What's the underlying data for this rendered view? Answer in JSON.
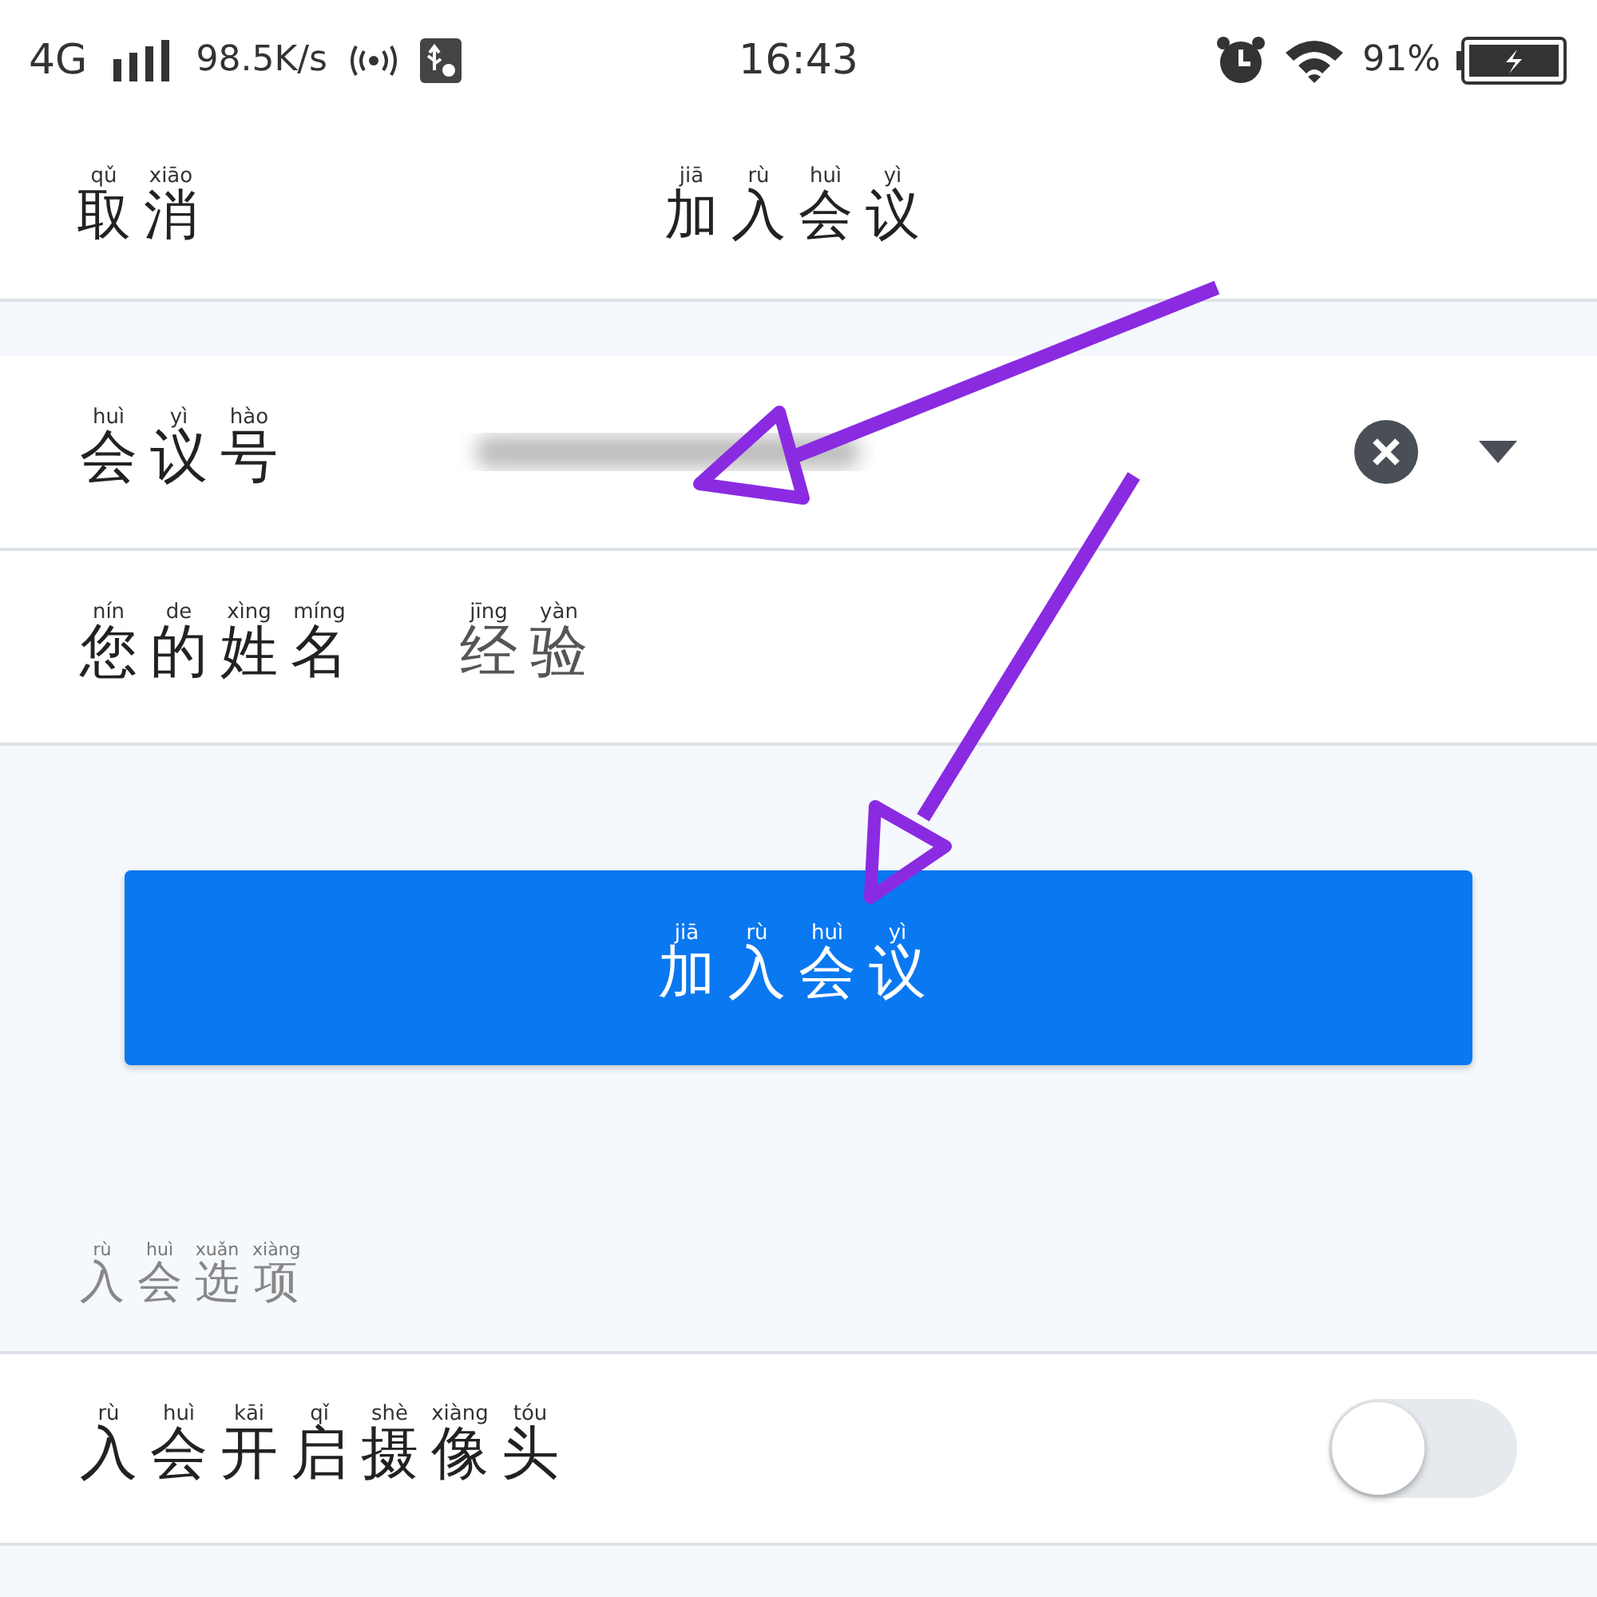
{
  "status_bar": {
    "network": "4G",
    "speed": "98.5K/s",
    "time": "16:43",
    "battery": "91%"
  },
  "header": {
    "cancel": [
      {
        "c": "取",
        "p": "qǔ"
      },
      {
        "c": "消",
        "p": "xiāo"
      }
    ],
    "title": [
      {
        "c": "加",
        "p": "jiā"
      },
      {
        "c": "入",
        "p": "rù"
      },
      {
        "c": "会",
        "p": "huì"
      },
      {
        "c": "议",
        "p": "yì"
      }
    ]
  },
  "fields": [
    {
      "label": [
        {
          "c": "会",
          "p": "huì"
        },
        {
          "c": "议",
          "p": "yì"
        },
        {
          "c": "号",
          "p": "hào"
        }
      ],
      "kind": "meeting_number"
    },
    {
      "label": [
        {
          "c": "您",
          "p": "nín"
        },
        {
          "c": "的",
          "p": "de"
        },
        {
          "c": "姓",
          "p": "xìng"
        },
        {
          "c": "名",
          "p": "míng"
        }
      ],
      "kind": "name",
      "value": [
        {
          "c": "经",
          "p": "jīng"
        },
        {
          "c": "验",
          "p": "yàn"
        }
      ]
    }
  ],
  "join_button": [
    {
      "c": "加",
      "p": "jiā"
    },
    {
      "c": "入",
      "p": "rù"
    },
    {
      "c": "会",
      "p": "huì"
    },
    {
      "c": "议",
      "p": "yì"
    }
  ],
  "options_heading": [
    {
      "c": "入",
      "p": "rù"
    },
    {
      "c": "会",
      "p": "huì"
    },
    {
      "c": "选",
      "p": "xuǎn"
    },
    {
      "c": "项",
      "p": "xiàng"
    }
  ],
  "options": [
    {
      "label": [
        {
          "c": "入",
          "p": "rù"
        },
        {
          "c": "会",
          "p": "huì"
        },
        {
          "c": "开",
          "p": "kāi"
        },
        {
          "c": "启",
          "p": "qǐ"
        },
        {
          "c": "摄",
          "p": "shè"
        },
        {
          "c": "像",
          "p": "xiàng"
        },
        {
          "c": "头",
          "p": "tóu"
        }
      ],
      "on": false
    }
  ]
}
